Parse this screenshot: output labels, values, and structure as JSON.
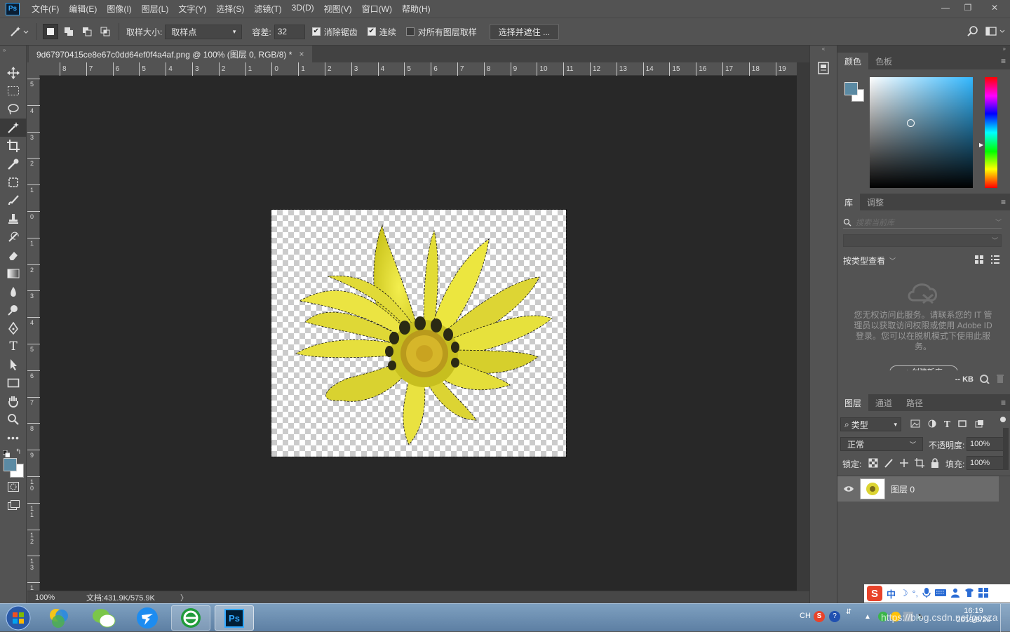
{
  "app": {
    "logo_text": "Ps"
  },
  "menu": [
    "文件(F)",
    "编辑(E)",
    "图像(I)",
    "图层(L)",
    "文字(Y)",
    "选择(S)",
    "滤镜(T)",
    "3D(D)",
    "视图(V)",
    "窗口(W)",
    "帮助(H)"
  ],
  "window_controls": {
    "minimize": "—",
    "restore": "❐",
    "close": "✕"
  },
  "options": {
    "sample_size_label": "取样大小:",
    "sample_size_value": "取样点",
    "tolerance_label": "容差:",
    "tolerance_value": "32",
    "anti_alias_label": "消除锯齿",
    "anti_alias_checked": true,
    "contiguous_label": "连续",
    "contiguous_checked": true,
    "all_layers_label": "对所有图层取样",
    "all_layers_checked": false,
    "select_mask_button": "选择并遮住 ..."
  },
  "document": {
    "tab_title": "9d67970415ce8e67c0dd64ef0f4a4af.png @ 100% (图层 0, RGB/8) *",
    "close": "×",
    "ruler_h": [
      "8",
      "7",
      "6",
      "5",
      "4",
      "3",
      "2",
      "1",
      "0",
      "1",
      "2",
      "3",
      "4",
      "5",
      "6",
      "7",
      "8",
      "9",
      "10",
      "11",
      "12",
      "13",
      "14",
      "15",
      "16",
      "17",
      "18",
      "19"
    ],
    "ruler_v": [
      "5",
      "4",
      "3",
      "2",
      "1",
      "0",
      "1",
      "2",
      "3",
      "4",
      "5",
      "6",
      "7",
      "8",
      "9",
      "1\n0",
      "1\n1",
      "1\n2",
      "1\n3",
      "1"
    ],
    "zoom": "100%",
    "doc_info": "文档:431.9K/575.9K",
    "arrow": "〉"
  },
  "color_panel": {
    "tabs": [
      "颜色",
      "色板"
    ],
    "foreground": "#5b8aa3",
    "background": "#ffffff",
    "hue_color": "#33b8ff"
  },
  "library_panel": {
    "tabs": [
      "库",
      "调整"
    ],
    "search_placeholder": "搜索当前库",
    "view_by_label": "按类型查看",
    "message": "您无权访问此服务。请联系您的 IT 管理员以获取访问权限或使用 Adobe ID 登录。您可以在脱机模式下使用此服务。",
    "create_button": "+ 创建新库",
    "kb_label": "-- KB"
  },
  "layers_panel": {
    "tabs": [
      "图层",
      "通道",
      "路径"
    ],
    "filter_label": "类型",
    "blend_mode": "正常",
    "opacity_label": "不透明度:",
    "opacity_value": "100%",
    "lock_label": "锁定:",
    "fill_label": "填充:",
    "fill_value": "100%",
    "layers": [
      {
        "name": "图层 0",
        "visible": true
      }
    ]
  },
  "taskbar": {
    "ime": "CH",
    "time": "16:19",
    "date": "2019/8/20",
    "url_watermark": "https://blog.csdn.net/gosza"
  },
  "tray_ime": [
    "中",
    "☽",
    "°,"
  ]
}
